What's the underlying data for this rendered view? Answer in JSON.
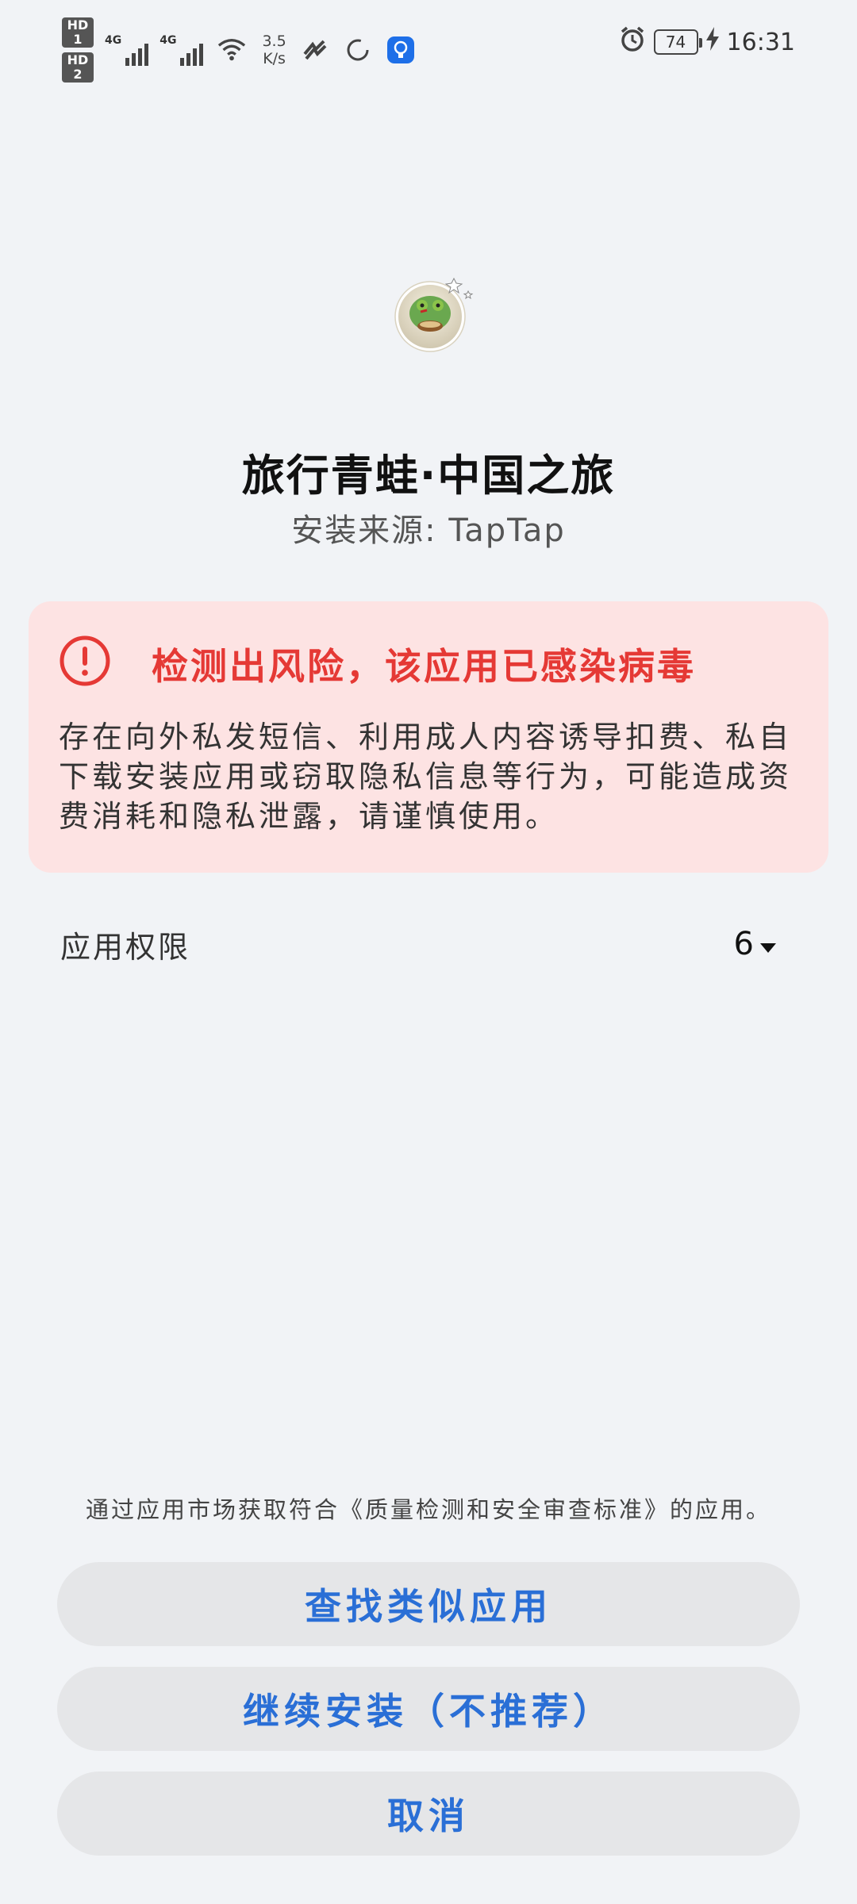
{
  "status_bar": {
    "sim1": "HD 1",
    "sim2": "HD 2",
    "net1": "4G",
    "net2": "4G",
    "speed_value": "3.5",
    "speed_unit": "K/s",
    "battery": "74",
    "time": "16:31",
    "icons": [
      "signal-icon",
      "wifi-icon",
      "app-notification-icon",
      "sync-icon",
      "assistant-icon",
      "alarm-icon",
      "battery-icon",
      "charging-icon"
    ]
  },
  "app": {
    "name": "旅行青蛙·中国之旅",
    "source": "安装来源: TapTap",
    "icon": "frog-app-icon"
  },
  "warning": {
    "title": "检测出风险，该应用已感染病毒",
    "body": "存在向外私发短信、利用成人内容诱导扣费、私自下载安装应用或窃取隐私信息等行为，可能造成资费消耗和隐私泄露，请谨慎使用。",
    "accent_color": "#e53935",
    "background_color": "#fde3e3"
  },
  "permissions": {
    "label": "应用权限",
    "count": "6"
  },
  "footer": {
    "note": "通过应用市场获取符合《质量检测和安全审查标准》的应用。",
    "buttons": {
      "find_similar": "查找类似应用",
      "continue_install": "继续安装（不推荐）",
      "cancel": "取消"
    },
    "button_text_color": "#2a6fd6"
  }
}
